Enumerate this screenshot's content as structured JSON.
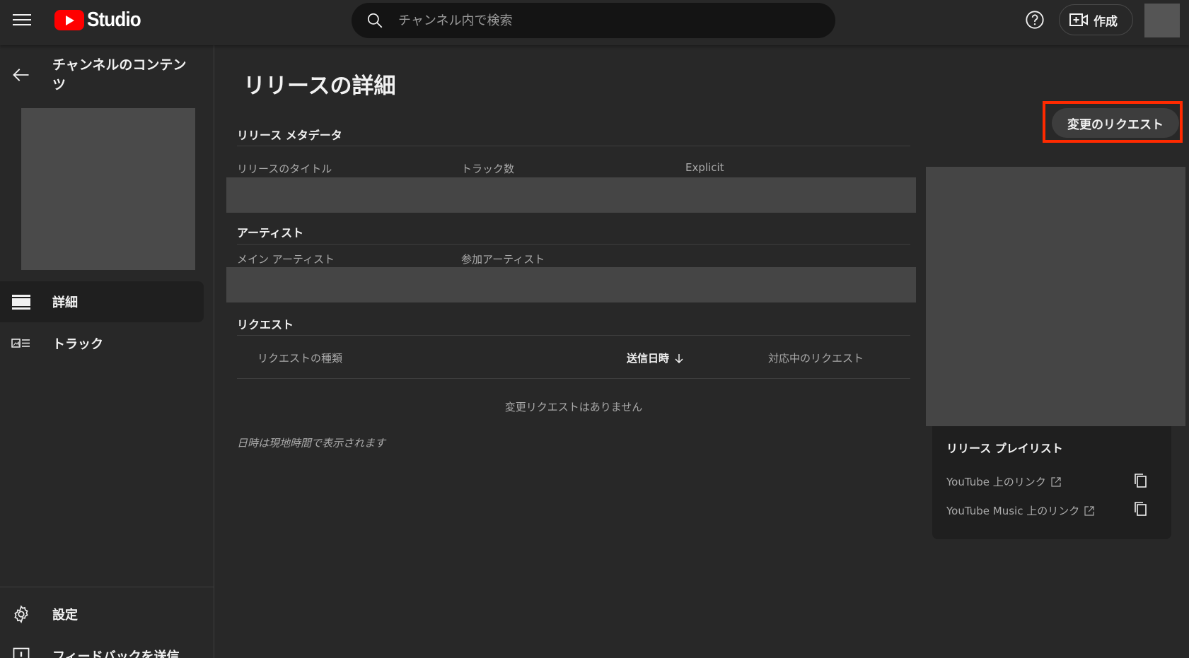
{
  "header": {
    "logo_text": "Studio",
    "search_placeholder": "チャンネル内で検索",
    "create_label": "作成"
  },
  "sidebar": {
    "title": "チャンネルのコンテンツ",
    "items": [
      {
        "label": "詳細",
        "icon": "details-icon",
        "active": true
      },
      {
        "label": "トラック",
        "icon": "tracks-icon",
        "active": false
      }
    ],
    "settings_label": "設定",
    "feedback_label": "フィードバックを送信"
  },
  "main": {
    "page_title": "リリースの詳細",
    "request_change_label": "変更のリクエスト",
    "metadata_section": {
      "title": "リリース メタデータ",
      "columns": [
        "リリースのタイトル",
        "トラック数",
        "Explicit"
      ]
    },
    "artist_section": {
      "title": "アーティスト",
      "columns": [
        "メイン アーティスト",
        "参加アーティスト"
      ]
    },
    "requests_section": {
      "title": "リクエスト",
      "headers": [
        "リクエストの種類",
        "送信日時",
        "対応中のリクエスト"
      ],
      "empty_text": "変更リクエストはありません",
      "footnote": "日時は現地時間で表示されます"
    }
  },
  "playlist": {
    "title": "リリース プレイリスト",
    "links": [
      "YouTube 上のリンク",
      "YouTube Music 上のリンク"
    ]
  },
  "colors": {
    "background": "#282828",
    "brand_red": "#ff0000",
    "highlight_border": "#ff2a00",
    "placeholder_block": "#454545"
  }
}
